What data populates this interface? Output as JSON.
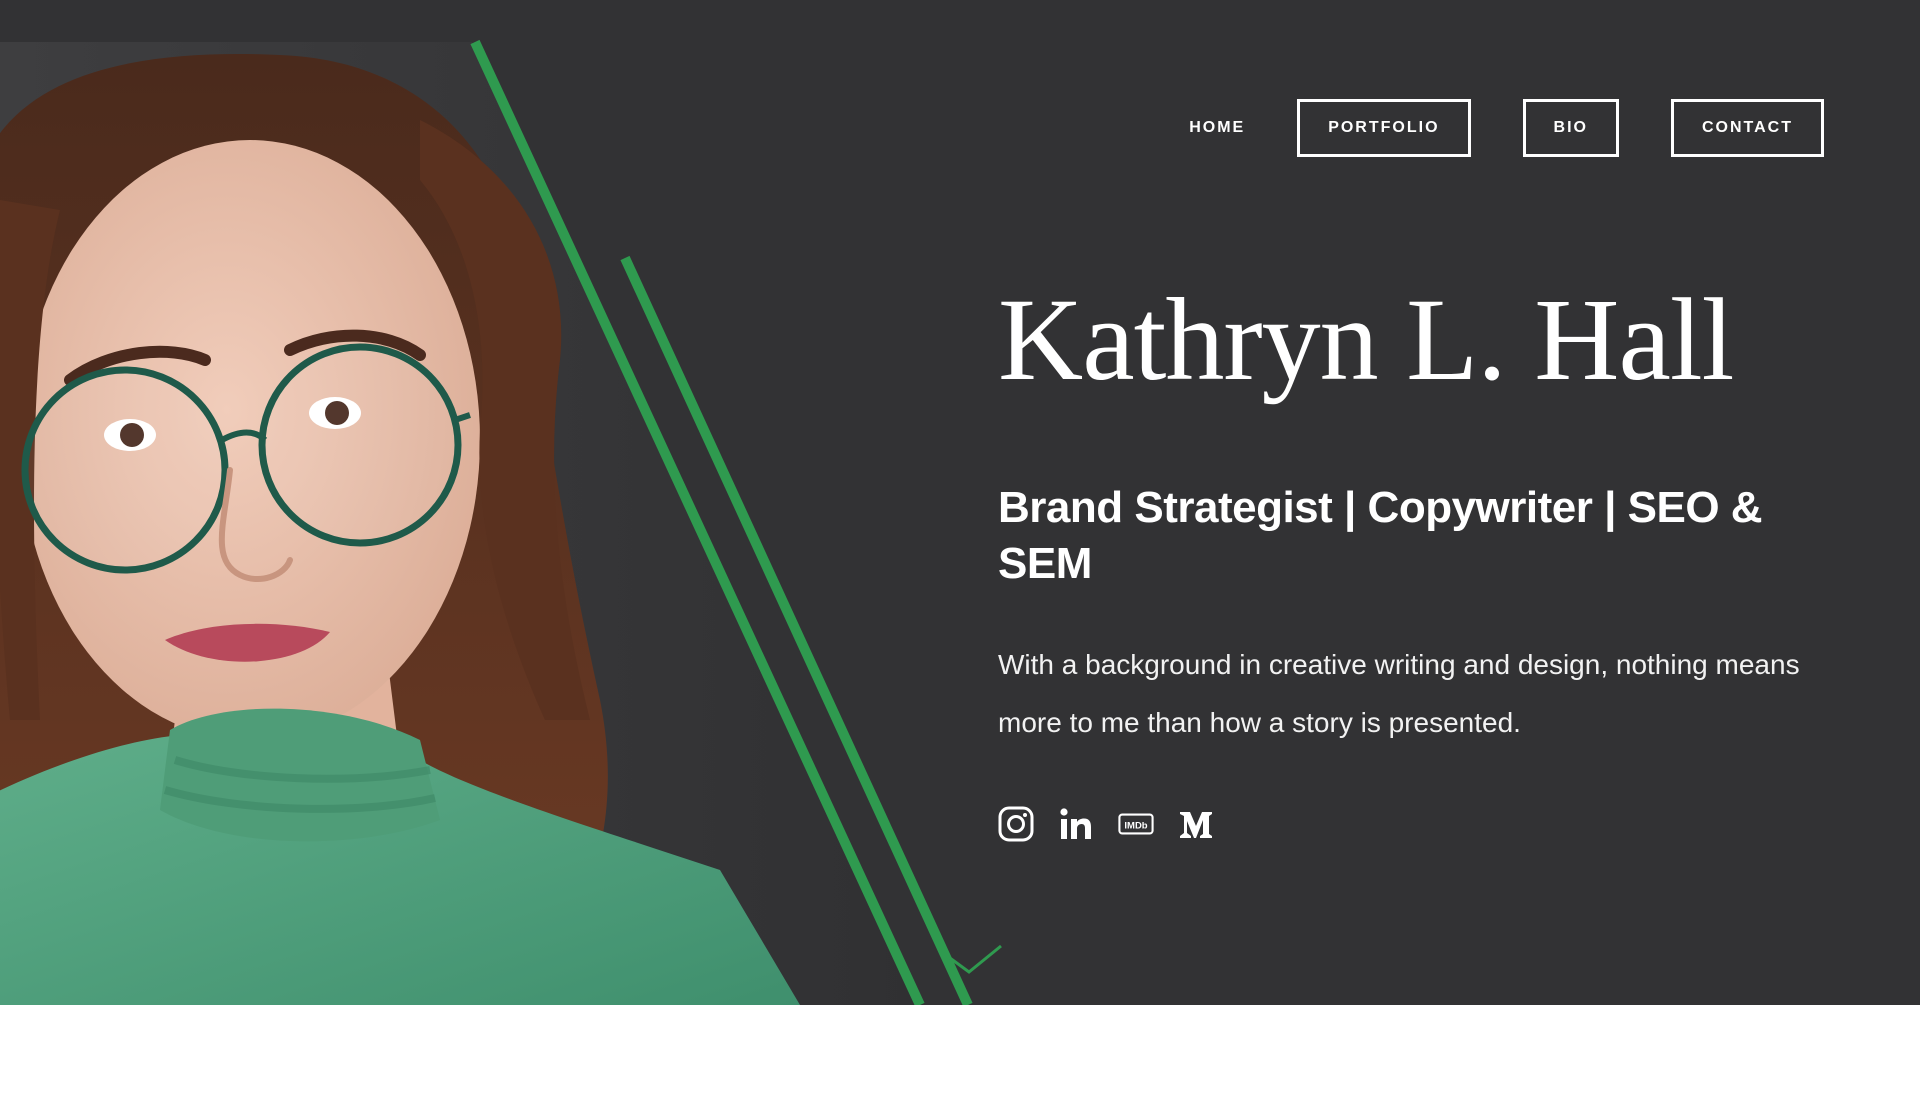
{
  "nav": {
    "items": [
      {
        "label": "HOME",
        "style": "plain"
      },
      {
        "label": "PORTFOLIO",
        "style": "boxed"
      },
      {
        "label": "BIO",
        "style": "boxed"
      },
      {
        "label": "CONTACT",
        "style": "boxed"
      }
    ]
  },
  "hero": {
    "name": "Kathryn L. Hall",
    "title": "Brand Strategist | Copywriter | SEO & SEM",
    "description": "With a background in creative writing and design, nothing means more to me than how a story is presented.",
    "photo_icon": "portrait-photo"
  },
  "socials": [
    {
      "name": "instagram-icon"
    },
    {
      "name": "linkedin-icon",
      "text": "in"
    },
    {
      "name": "imdb-icon",
      "text": "IMDb"
    },
    {
      "name": "medium-icon"
    }
  ],
  "scroll_icon": "chevron-down-icon",
  "colors": {
    "hero_bg": "#323234",
    "accent_green": "#2f9a4f",
    "text": "#ffffff",
    "page_bg": "#ffffff"
  }
}
